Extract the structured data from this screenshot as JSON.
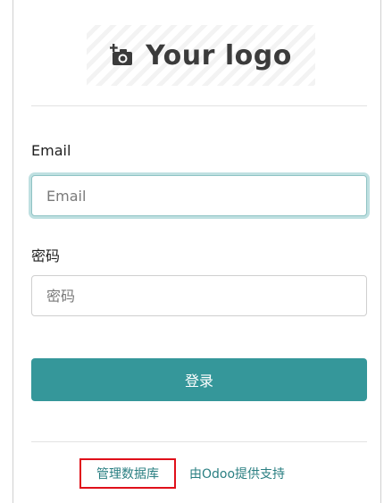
{
  "logo": {
    "text": "Your logo",
    "icon": "camera-add-icon"
  },
  "form": {
    "email_label": "Email",
    "email_placeholder": "Email",
    "email_value": "",
    "password_label": "密码",
    "password_placeholder": "密码",
    "password_value": "",
    "login_label": "登录"
  },
  "footer": {
    "manage_db_label": "管理数据库",
    "powered_by_label": "由Odoo提供支持"
  },
  "colors": {
    "primary": "#35979a",
    "link": "#2a7f82",
    "highlight_box": "#e0101a",
    "focus_ring": "#bfe0e1"
  }
}
